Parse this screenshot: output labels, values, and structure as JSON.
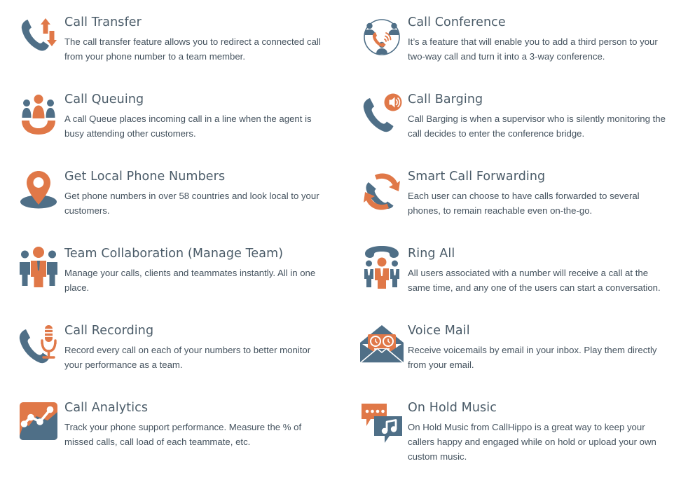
{
  "page": {
    "layout": "two-column-feature-grid",
    "columns": 2,
    "rows": 6,
    "background_color": "#ffffff",
    "accent_orange": "#E07848",
    "accent_slate": "#4F6F87",
    "heading_color": "#4a5b68",
    "body_color": "#44525e"
  },
  "features": [
    {
      "id": "call-transfer",
      "title": "Call Transfer",
      "description": "The call transfer feature allows you to redirect a connected call from your phone number to a team member.",
      "icon": "phone-transfer-arrows-icon",
      "column": "left"
    },
    {
      "id": "call-conference",
      "title": "Call Conference",
      "description": "It’s a feature that will enable you to add a third person to your two-way call and turn it into a 3-way conference.",
      "icon": "conference-circle-people-phone-icon",
      "column": "right"
    },
    {
      "id": "call-queuing",
      "title": "Call Queuing",
      "description": "A call Queue places incoming call in a line when the agent is busy attending other customers.",
      "icon": "three-people-queue-icon",
      "column": "left"
    },
    {
      "id": "call-barging",
      "title": "Call Barging",
      "description": "Call Barging is when a supervisor who is silently monitoring the call decides to enter the conference bridge.",
      "icon": "phone-speaker-badge-icon",
      "column": "right"
    },
    {
      "id": "get-local-phone-numbers",
      "title": "Get Local Phone Numbers",
      "description": "Get phone numbers in over 58 countries and look local to your customers.",
      "icon": "map-pin-location-icon",
      "column": "left"
    },
    {
      "id": "smart-call-forwarding",
      "title": "Smart Call Forwarding",
      "description": "Each user can choose to have calls forwarded to several phones, to remain reachable even on-the-go.",
      "icon": "phone-forward-arrows-icon",
      "column": "right"
    },
    {
      "id": "team-collaboration",
      "title": "Team Collaboration (Manage Team)",
      "description": "Manage your calls, clients and teammates instantly. All in one place.",
      "icon": "team-three-persons-icon",
      "column": "left"
    },
    {
      "id": "ring-all",
      "title": "Ring All",
      "description": "All users associated with a number will receive a call at the same time, and any one of the users can start a conversation.",
      "icon": "handset-over-team-icon",
      "column": "right"
    },
    {
      "id": "call-recording",
      "title": "Call Recording",
      "description": "Record every call on each of your numbers to better monitor your performance as a team.",
      "icon": "phone-microphone-icon",
      "column": "left"
    },
    {
      "id": "voice-mail",
      "title": "Voice Mail",
      "description": "Receive voicemails by email in your inbox. Play them directly from your email.",
      "icon": "envelope-tape-reel-icon",
      "column": "right"
    },
    {
      "id": "call-analytics",
      "title": "Call Analytics",
      "description": "Track your phone support performance. Measure the % of missed calls, call load of each teammate, etc.",
      "icon": "analytics-chart-square-icon",
      "column": "left"
    },
    {
      "id": "on-hold-music",
      "title": "On Hold Music",
      "description": "On Hold Music from CallHippo is a great way to keep your callers happy and engaged while on hold or upload your own custom music.",
      "icon": "chat-bubbles-music-icon",
      "column": "right"
    }
  ]
}
